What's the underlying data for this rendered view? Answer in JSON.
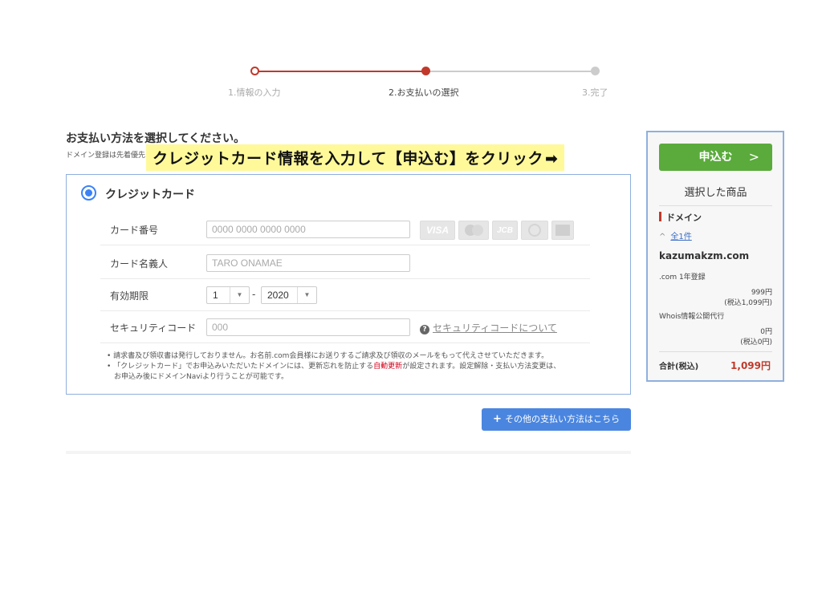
{
  "stepper": {
    "steps": [
      "1.情報の入力",
      "2.お支払いの選択",
      "3.完了"
    ]
  },
  "page": {
    "title": "お支払い方法を選択してください。",
    "note": "ドメイン登録は先着優先"
  },
  "annotation": {
    "text": "クレジットカード情報を入力して【申込む】をクリック",
    "arrow": "➡"
  },
  "credit_card": {
    "title": "クレジットカード",
    "card_number": {
      "label": "カード番号",
      "placeholder": "0000 0000 0000 0000",
      "value": ""
    },
    "card_name": {
      "label": "カード名義人",
      "placeholder": "TARO ONAMAE",
      "value": ""
    },
    "expiry": {
      "label": "有効期限",
      "month": "1",
      "separator": "-",
      "year": "2020"
    },
    "security": {
      "label": "セキュリティコード",
      "placeholder": "000",
      "value": "",
      "help_link": "セキュリティコードについて"
    },
    "logos": [
      "VISA",
      "Mastercard",
      "JCB",
      "Diners Club",
      "American Express"
    ],
    "logo_text_visa": "VISA",
    "logo_text_jcb": "JCB",
    "notes": {
      "line1": "• 請求書及び領収書は発行しておりません。お名前.com会員様にお送りするご請求及び領収のメールをもって代えさせていただきます。",
      "line2_pre": "• 「クレジットカード」でお申込みいただいたドメインには、更新忘れを防止する",
      "line2_red": "自動更新",
      "line2_post": "が設定されます。設定解除・支払い方法変更は、",
      "line3": "お申込み後にドメインNaviより行うことが可能です。"
    }
  },
  "other_payment": {
    "label": "その他の支払い方法はこちら",
    "icon": "plus-icon"
  },
  "cart": {
    "apply_label": "申込む",
    "apply_chevron": ">",
    "heading": "選択した商品",
    "section_label": "ドメイン",
    "toggle_arrow": "^",
    "toggle_label": "全1件",
    "domain": "kazumakzm.com",
    "items": [
      {
        "name": ".com 1年登録",
        "price": "999円",
        "tax": "(税込1,099円)"
      },
      {
        "name": "Whois情報公開代行",
        "price": "0円",
        "tax": "(税込0円)"
      }
    ],
    "total_label": "合計(税込)",
    "total_value": "1,099円"
  },
  "colors": {
    "accent_red": "#c0392b",
    "panel_border": "#8fb0dd",
    "radio_blue": "#3b82f6",
    "apply_green": "#5aab3b",
    "other_pay_blue": "#4a86e0",
    "annotation_yellow": "#fff99a"
  }
}
